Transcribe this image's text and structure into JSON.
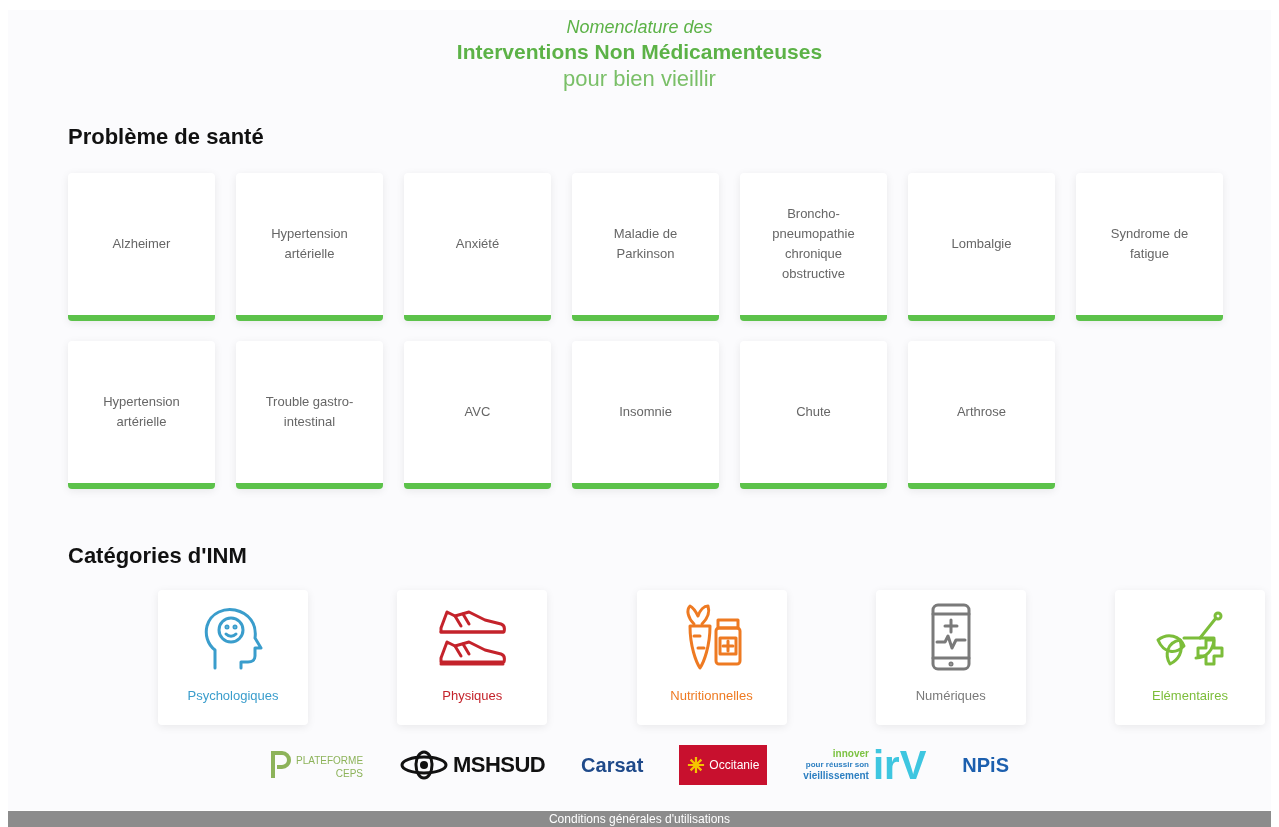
{
  "header": {
    "line_1": "Nomenclature des",
    "line_2": "Interventions Non Médicamenteuses",
    "line_3": "pour bien vieillir"
  },
  "health_section": {
    "title": "Problème de santé",
    "items": [
      "Alzheimer",
      "Hypertension artérielle",
      "Anxiété",
      "Maladie de Parkinson",
      "Broncho-pneumopathie chronique obstructive",
      "Lombalgie",
      "Syndrome de fatigue",
      "Hypertension artérielle",
      "Trouble gastro-intestinal",
      "AVC",
      "Insomnie",
      "Chute",
      "Arthrose"
    ]
  },
  "categories_section": {
    "title": "Catégories d'INM",
    "items": [
      {
        "label": "Psychologiques",
        "kind": "head",
        "color": "#3a9dcc"
      },
      {
        "label": "Physiques",
        "kind": "shoes",
        "color": "#c4232b"
      },
      {
        "label": "Nutritionnelles",
        "kind": "carrot",
        "color": "#ee7a22"
      },
      {
        "label": "Numériques",
        "kind": "phone",
        "color": "#7a7a7a"
      },
      {
        "label": "Elémentaires",
        "kind": "herbs",
        "color": "#7cbd3a"
      }
    ]
  },
  "partners": [
    {
      "kind": "ceps",
      "texts": [
        "PLATEFORME",
        "CEPS"
      ]
    },
    {
      "kind": "mshsud",
      "texts": [
        "MSHSUD"
      ]
    },
    {
      "kind": "carsat",
      "texts": [
        "Carsat"
      ]
    },
    {
      "kind": "occitanie",
      "texts": [
        "Occitanie"
      ]
    },
    {
      "kind": "irv",
      "texts": [
        "innover",
        "pour réussir son",
        "vieillissement",
        "irV"
      ]
    },
    {
      "kind": "npis",
      "texts": [
        "NPiS"
      ]
    }
  ],
  "footer": {
    "link": "Conditions générales d'utilisations"
  }
}
